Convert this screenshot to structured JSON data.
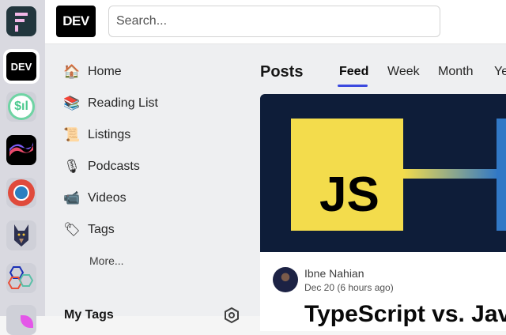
{
  "rail": {
    "items": [
      {
        "icon": "forem-icon"
      },
      {
        "icon": "dev-icon",
        "label": "DEV"
      },
      {
        "icon": "dollar-signal-icon"
      },
      {
        "icon": "wave-icon"
      },
      {
        "icon": "community-globe-icon"
      },
      {
        "icon": "doberman-icon"
      },
      {
        "icon": "hexagons-icon"
      },
      {
        "icon": "pink-leaf-icon"
      }
    ]
  },
  "header": {
    "logo": "DEV",
    "search_placeholder": "Search..."
  },
  "sidebar": {
    "items": [
      {
        "label": "Home",
        "icon": "🏠"
      },
      {
        "label": "Reading List",
        "icon": "📚"
      },
      {
        "label": "Listings",
        "icon": "📜"
      },
      {
        "label": "Podcasts",
        "icon": "🎙"
      },
      {
        "label": "Videos",
        "icon": "📹"
      },
      {
        "label": "Tags",
        "icon": "🏷"
      }
    ],
    "more": "More...",
    "my_tags": "My Tags"
  },
  "main": {
    "title": "Posts",
    "tabs": [
      {
        "label": "Feed",
        "active": true
      },
      {
        "label": "Week"
      },
      {
        "label": "Month"
      },
      {
        "label": "Year"
      }
    ],
    "post": {
      "cover_text": "JS",
      "author": "Ibne Nahian",
      "date": "Dec 20 (6 hours ago)",
      "title": "TypeScript vs. Java"
    }
  },
  "colors": {
    "accent": "#3b49df",
    "js_yellow": "#f3dc4c",
    "cover_bg": "#0e1d39",
    "ts_blue": "#3178c6"
  }
}
